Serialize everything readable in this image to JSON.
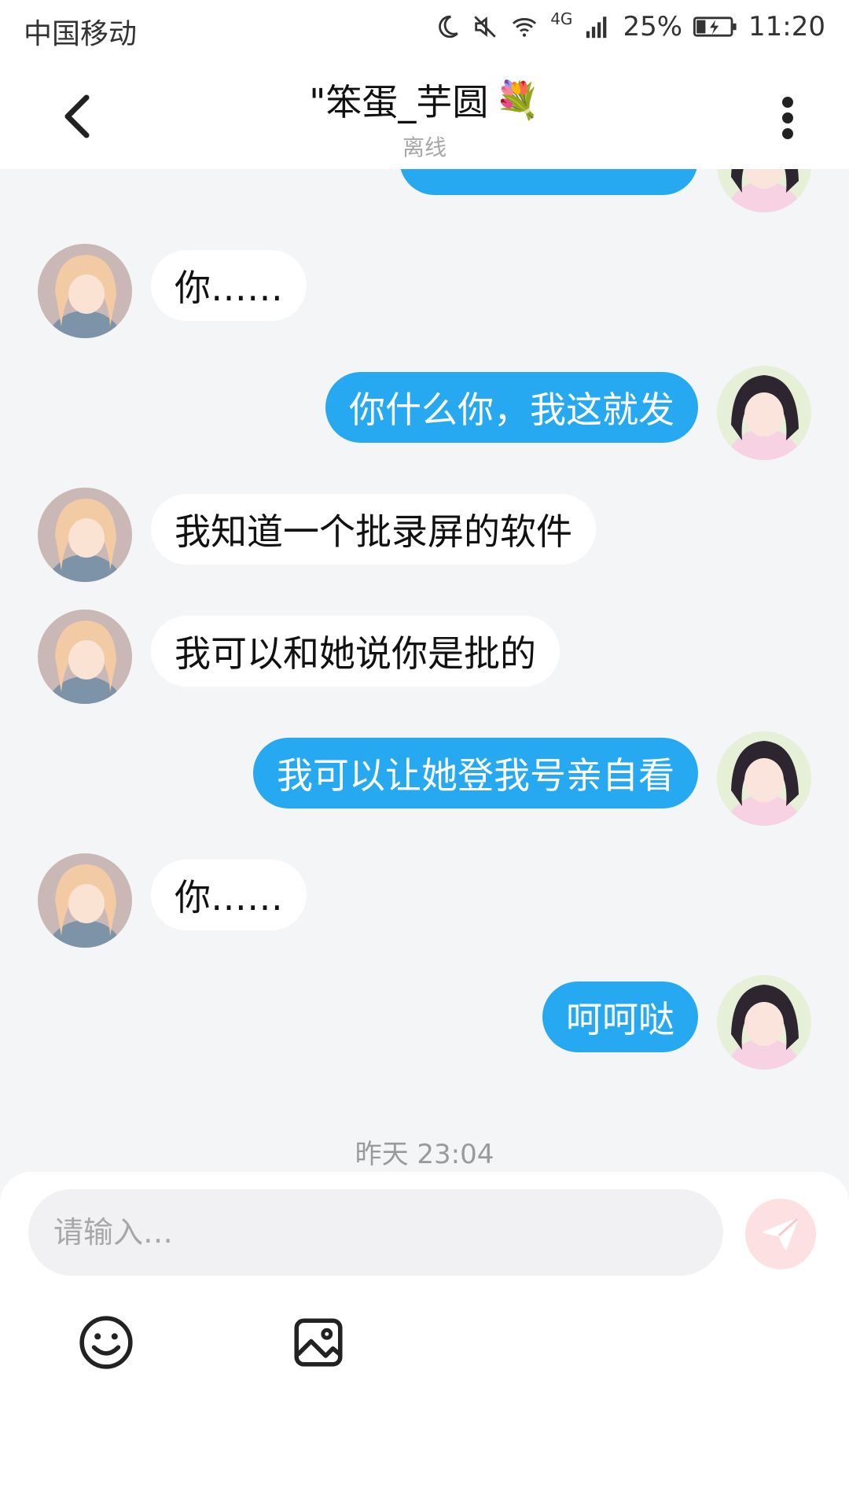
{
  "status_bar": {
    "carrier": "中国移动",
    "network": "4G",
    "battery": "25%",
    "time": "11:20"
  },
  "header": {
    "title": "\"笨蛋_芋圆",
    "title_emoji": "💐",
    "status": "离线"
  },
  "messages": [
    {
      "side": "right",
      "text": ""
    },
    {
      "side": "left",
      "text": "你……"
    },
    {
      "side": "right",
      "text": "你什么你，我这就发"
    },
    {
      "side": "left",
      "text": "我知道一个批录屏的软件"
    },
    {
      "side": "left",
      "text": "我可以和她说你是批的"
    },
    {
      "side": "right",
      "text": "我可以让她登我号亲自看"
    },
    {
      "side": "left",
      "text": "你……"
    },
    {
      "side": "right",
      "text": "呵呵哒"
    }
  ],
  "timestamp": "昨天 23:04",
  "composer": {
    "placeholder": "请输入…",
    "icons": [
      "emoji-icon",
      "image-icon",
      "send-icon"
    ]
  },
  "colors": {
    "outgoing_bubble": "#27a9f2",
    "incoming_bubble": "#ffffff",
    "send_button": "#fde1e2",
    "background": "#f4f5f7"
  }
}
